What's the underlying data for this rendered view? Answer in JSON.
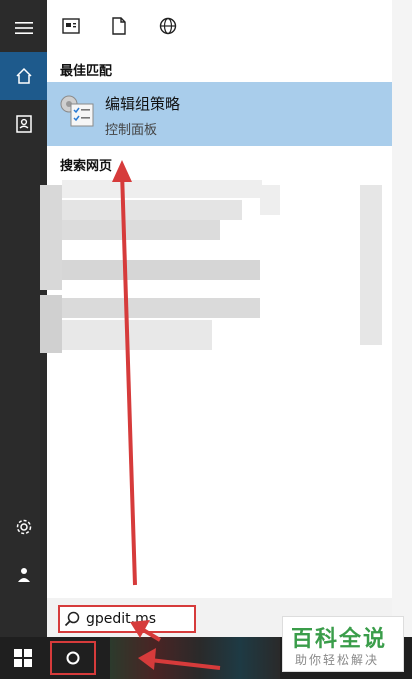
{
  "toolbar": {
    "more_label": "···"
  },
  "sections": {
    "best_match": "最佳匹配",
    "web_search": "搜索网页"
  },
  "best_result": {
    "title": "编辑组策略",
    "subtitle": "控制面板"
  },
  "search": {
    "value": "gpedit.ms"
  },
  "watermark": {
    "main": "百科全说",
    "sub": "助你轻松解决"
  },
  "colors": {
    "accent": "#1e5a8c",
    "selection": "#a9cdeb",
    "annotation": "#d63b3b",
    "watermark": "#3a9d4a"
  }
}
